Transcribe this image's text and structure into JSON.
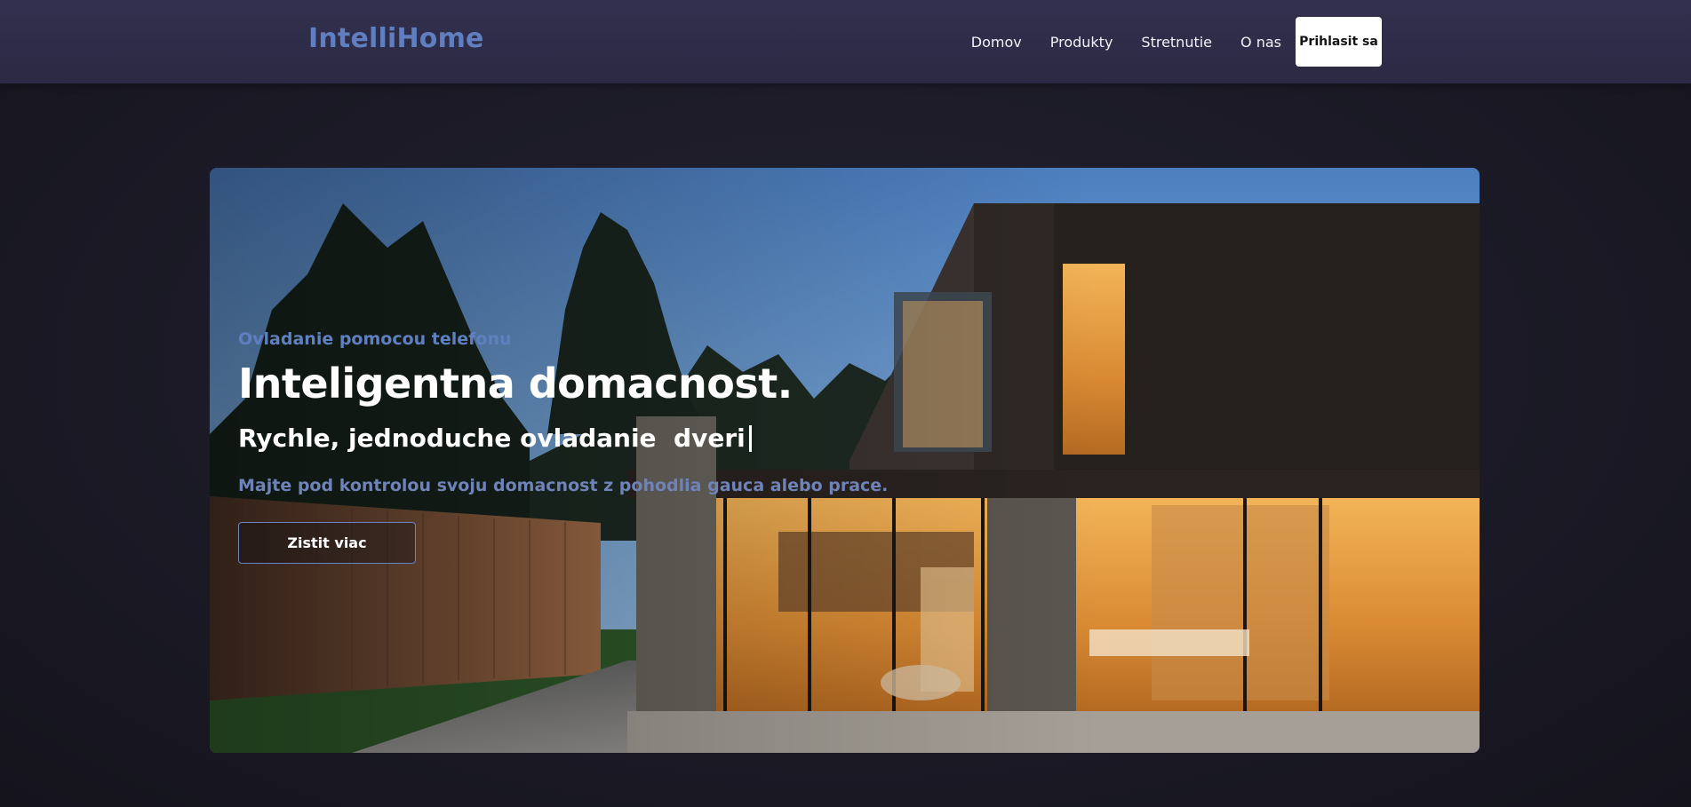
{
  "header": {
    "logo": "IntelliHome",
    "nav": [
      "Domov",
      "Produkty",
      "Stretnutie",
      "O nas"
    ],
    "login_label": "Prihlasit sa"
  },
  "hero": {
    "eyebrow": "Ovladanie pomocou telefonu",
    "title": "Inteligentna domacnost.",
    "subtitle": "Rychle, jednoduche ovladanie  dveri",
    "description": "Majte pod kontrolou svoju domacnost z pohodlia gauca alebo prace.",
    "cta_label": "Zistit viac",
    "image": "modern-smart-house-at-dusk"
  },
  "colors": {
    "accent": "#5f7fc0",
    "navbar": "#2f2c48",
    "background": "#1b1a26"
  }
}
